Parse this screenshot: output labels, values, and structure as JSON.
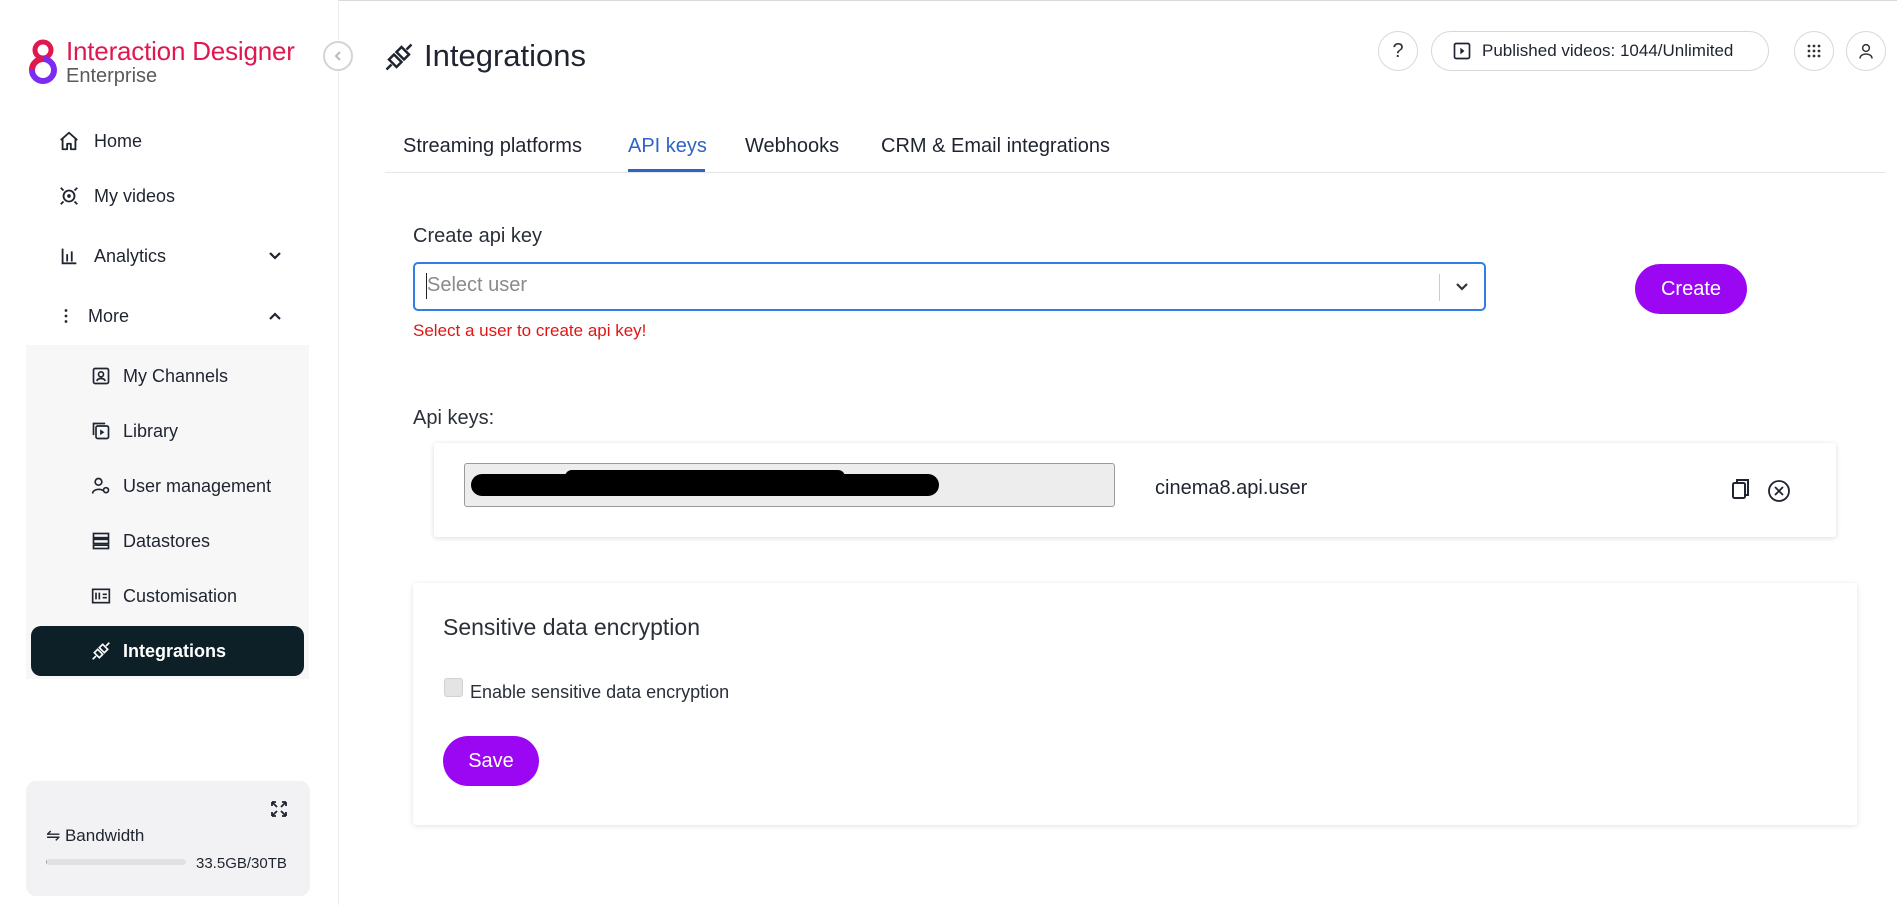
{
  "brand": {
    "title": "Interaction Designer",
    "subtitle": "Enterprise"
  },
  "sidebar": {
    "items": [
      {
        "label": "Home",
        "icon": "home-icon"
      },
      {
        "label": "My videos",
        "icon": "videos-icon"
      },
      {
        "label": "Analytics",
        "icon": "analytics-icon"
      },
      {
        "label": "More",
        "icon": "more-icon"
      }
    ],
    "submenu": [
      {
        "label": "My Channels",
        "icon": "channels-icon"
      },
      {
        "label": "Library",
        "icon": "library-icon"
      },
      {
        "label": "User management",
        "icon": "user-management-icon"
      },
      {
        "label": "Datastores",
        "icon": "datastores-icon"
      },
      {
        "label": "Customisation",
        "icon": "customisation-icon"
      },
      {
        "label": "Integrations",
        "icon": "integrations-icon",
        "active": true
      }
    ],
    "bandwidth": {
      "label": "⇋ Bandwidth",
      "value": "33.5GB/30TB",
      "used_fraction": 0.001
    }
  },
  "header": {
    "title": "Integrations",
    "help": "?",
    "published": "Published videos: 1044/Unlimited"
  },
  "tabs": [
    {
      "label": "Streaming platforms",
      "active": false
    },
    {
      "label": "API keys",
      "active": true
    },
    {
      "label": "Webhooks",
      "active": false
    },
    {
      "label": "CRM & Email integrations",
      "active": false
    }
  ],
  "create": {
    "label": "Create api key",
    "placeholder": "Select user",
    "error": "Select a user to create api key!",
    "button": "Create"
  },
  "keys": {
    "label": "Api keys:",
    "items": [
      {
        "user": "cinema8.api.user",
        "key_redacted": true
      }
    ]
  },
  "encryption": {
    "title": "Sensitive data encryption",
    "checkbox_label": "Enable sensitive data encryption",
    "checked": false,
    "save": "Save"
  },
  "colors": {
    "brand": "#e0184f",
    "accent": "#9b07f2",
    "tab_active": "#2f63c4",
    "error": "#e01515",
    "active_nav_bg": "#0e2027"
  }
}
